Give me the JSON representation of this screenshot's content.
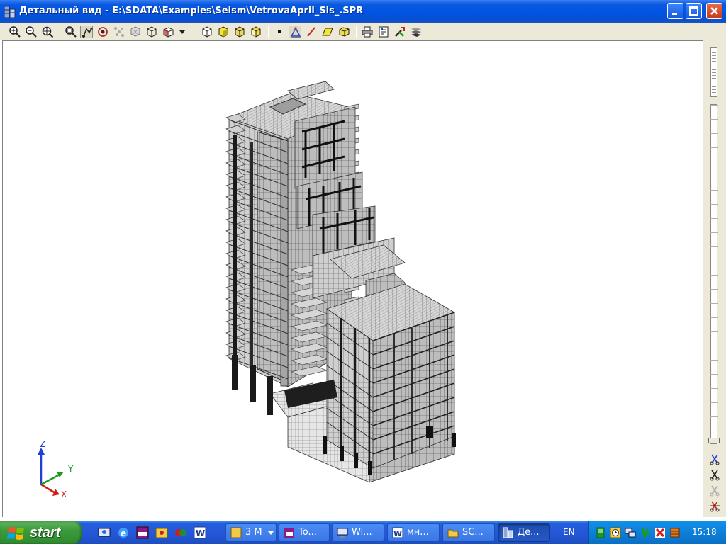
{
  "window": {
    "title": "Детальный вид - E:\\SDATA\\Examples\\Seism\\VetrovaApril_Sis_.SPR",
    "icon": "building-app-icon",
    "controls": [
      "minimize",
      "maximize",
      "close"
    ]
  },
  "toolbar": {
    "buttons": [
      {
        "name": "zoom-in-icon"
      },
      {
        "name": "zoom-out-icon"
      },
      {
        "name": "zoom-all-icon"
      },
      {
        "name": "zoom-window-icon"
      },
      {
        "name": "pan-icon",
        "pressed": true
      },
      {
        "name": "rotate-icon"
      },
      {
        "name": "dynamic-rotate-icon"
      },
      {
        "name": "orbit-icon"
      },
      {
        "name": "projection-icon"
      },
      {
        "name": "view-cube-icon"
      },
      {
        "name": "view-dropdown-icon"
      },
      {
        "name": "wireframe-icon"
      },
      {
        "name": "shade-icon"
      },
      {
        "name": "solid-icon"
      },
      {
        "name": "render-icon"
      },
      {
        "name": "node-icon"
      },
      {
        "name": "supports-icon"
      },
      {
        "name": "bar-icon"
      },
      {
        "name": "plate-icon"
      },
      {
        "name": "solid-element-icon"
      },
      {
        "name": "print-icon"
      },
      {
        "name": "properties-icon"
      },
      {
        "name": "tools-icon"
      },
      {
        "name": "layers-icon"
      }
    ]
  },
  "viewport": {
    "background": "#ffffff",
    "model_color": "#c8c8c8",
    "mesh_color": "#3a3a3a",
    "axes": {
      "z": "Z",
      "y": "Y",
      "x": "X",
      "colors": {
        "z": "#1f3fd6",
        "y": "#1c9a1c",
        "x": "#d21c1c"
      }
    }
  },
  "taskbar": {
    "start_label": "start",
    "quick_launch": [
      "desktop-icon",
      "ie-icon",
      "app-icon",
      "explorer-icon",
      "paint-icon",
      "word-icon"
    ],
    "tasks": [
      {
        "label": "3 M",
        "icon": "group-icon",
        "dropdown": true
      },
      {
        "label": "To...",
        "icon": "app-icon"
      },
      {
        "label": "Wi...",
        "icon": "computer-icon"
      },
      {
        "label": "мн...",
        "icon": "word-icon"
      },
      {
        "label": "SC...",
        "icon": "folder-icon"
      },
      {
        "label": "Де...",
        "icon": "building-app-icon",
        "active": true
      }
    ],
    "language": "EN",
    "tray_icons": [
      "green-book-icon",
      "clock-tray-icon",
      "network-icon",
      "plug-icon",
      "antivirus-icon",
      "archive-icon"
    ],
    "clock": "15:18"
  }
}
